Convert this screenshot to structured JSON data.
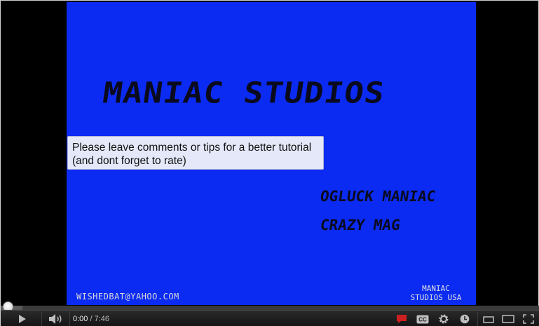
{
  "video": {
    "title_art": "MANIAC STUDIOS",
    "line1": "OGLUCK MANIAC",
    "line2": "CRAZY MAG",
    "email": "WISHEDBAT@YAHOO.COM",
    "brand_line1": "MANIAC",
    "brand_line2": "STUDIOS USA"
  },
  "annotation": {
    "text": "Please leave comments or tips for a better tutorial (and dont forget to rate)"
  },
  "player": {
    "current_time": "0:00",
    "separator": " / ",
    "duration": "7:46",
    "progress_fraction": 0.0,
    "buffered_fraction": 0.04
  },
  "colors": {
    "video_bg": "#0b2bf2",
    "accent_red": "#cc2020"
  },
  "icons": [
    "play-icon",
    "volume-icon",
    "annotations-icon",
    "captions-icon",
    "settings-icon",
    "watch-later-icon",
    "small-player-icon",
    "large-player-icon",
    "fullscreen-icon"
  ]
}
